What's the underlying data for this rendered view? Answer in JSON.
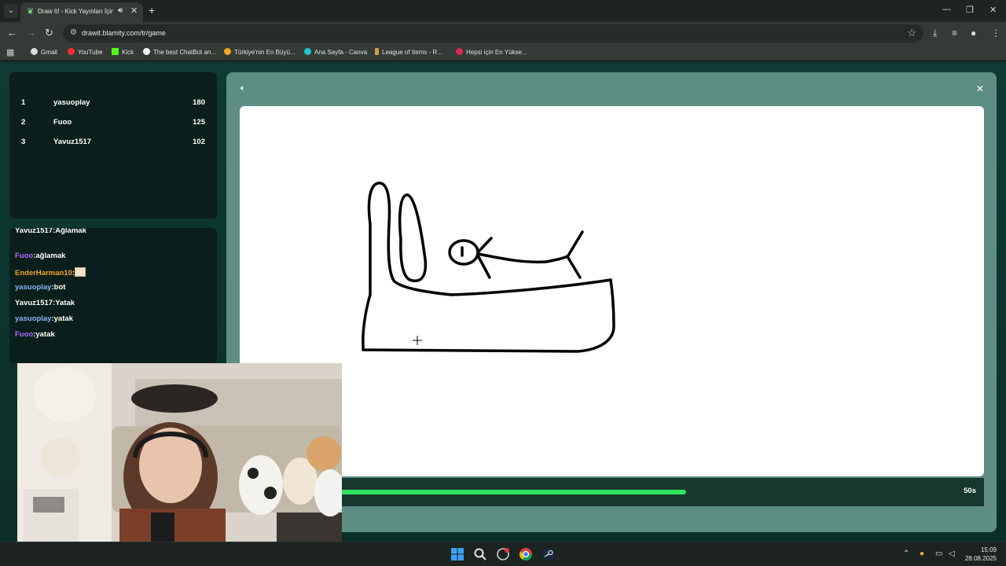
{
  "browser": {
    "tab": {
      "title": "Draw It! - Kick Yayınları İçin",
      "favicon": "leaf-icon",
      "audio_icon": "speaker-icon"
    },
    "window_controls": [
      "minimize-icon",
      "maximize-icon",
      "close-icon"
    ],
    "url": "drawit.blamity.com/tr/game",
    "bookmarks": [
      {
        "label": "Gmail",
        "color": "#d9dcda"
      },
      {
        "label": "YouTube",
        "color": "#ff2d2d"
      },
      {
        "label": "Kick",
        "color": "#53fc18"
      },
      {
        "label": "The best ChatBot an...",
        "color": "#ffffff"
      },
      {
        "label": "Türkiye'nin En Büyü...",
        "color": "#f5a623"
      },
      {
        "label": "Ana Sayfa - Canva",
        "color": "#20c4cb"
      },
      {
        "label": "League of Items - R...",
        "color": "#c8a24a"
      },
      {
        "label": "Hepsi için En Yükse...",
        "color": "#e0284f"
      }
    ]
  },
  "leaderboard": [
    {
      "rank": "1",
      "name": "yasuoplay",
      "score": "180"
    },
    {
      "rank": "2",
      "name": "Fuoo",
      "score": "125"
    },
    {
      "rank": "3",
      "name": "Yavuz1517",
      "score": "102"
    }
  ],
  "chat": [
    {
      "user": "Yavuz1517",
      "text": "Ağlamak",
      "color": "#ffffff"
    },
    {
      "user": "Fuoo",
      "text": "ağlamak",
      "color": "#b36bff"
    },
    {
      "user": "EnderHarman10",
      "text": "",
      "color": "#f5a623",
      "emote": true
    },
    {
      "user": "yasuoplay",
      "text": "bot",
      "color": "#8ab4f8"
    },
    {
      "user": "Yavuz1517",
      "text": "Yatak",
      "color": "#ffffff"
    },
    {
      "user": "yasuoplay",
      "text": "yatak",
      "color": "#8ab4f8"
    },
    {
      "user": "Fuoo",
      "text": "yatak",
      "color": "#b36bff"
    }
  ],
  "game": {
    "timer_label": "50s",
    "timer_progress": 0.6,
    "accent": "#2fe35e"
  },
  "taskbar": {
    "apps": [
      "windows-start-icon",
      "search-icon",
      "game-bar-icon",
      "chrome-icon",
      "steam-icon"
    ],
    "time": "15:09",
    "date": "28.08.2025"
  }
}
